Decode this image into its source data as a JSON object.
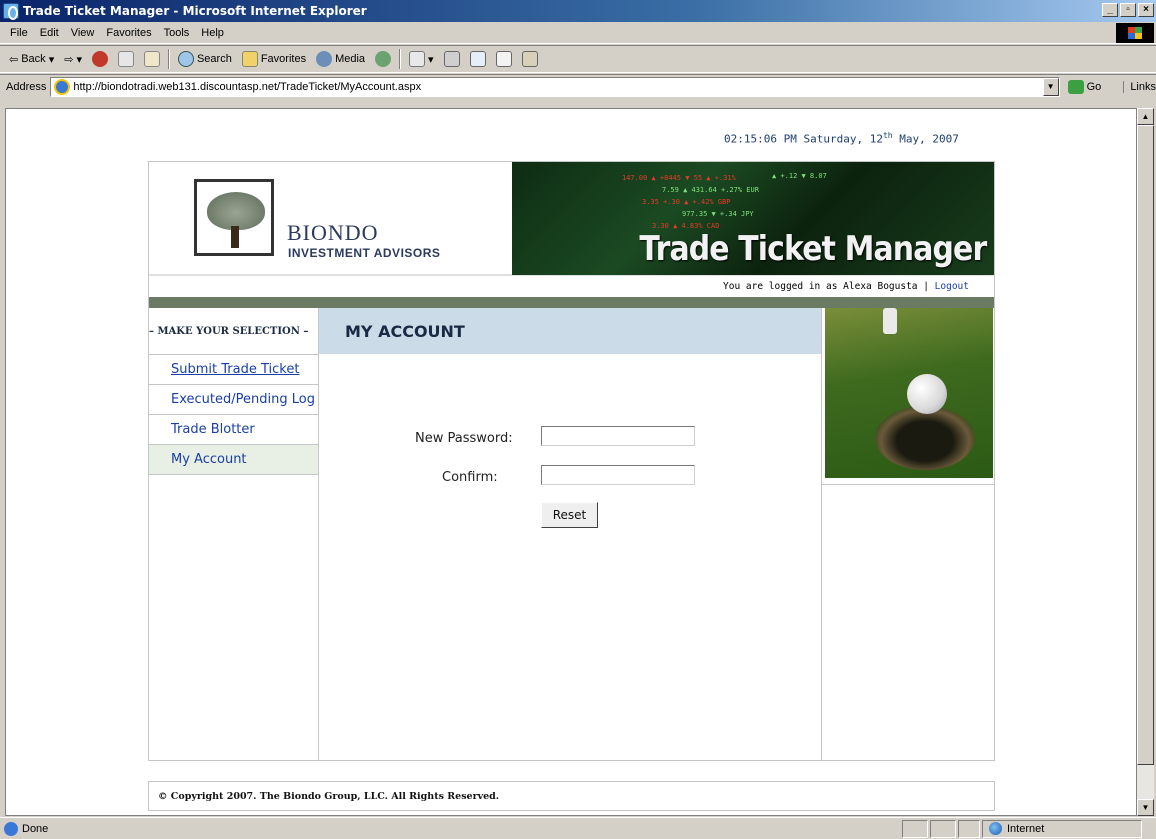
{
  "window": {
    "title": "Trade Ticket Manager - Microsoft Internet Explorer",
    "buttons": {
      "minimize": "_",
      "maximize": "▫",
      "close": "×"
    }
  },
  "menu": {
    "items": [
      "File",
      "Edit",
      "View",
      "Favorites",
      "Tools",
      "Help"
    ]
  },
  "toolbar": {
    "back": "Back",
    "search": "Search",
    "favorites": "Favorites",
    "media": "Media"
  },
  "address": {
    "label": "Address",
    "url": "http://biondotradi.web131.discountasp.net/TradeTicket/MyAccount.aspx",
    "go": "Go",
    "links": "Links"
  },
  "status": {
    "text": "Done",
    "zone": "Internet"
  },
  "page": {
    "datetime": {
      "time_day": "02:15:06 PM Saturday, 12",
      "ordinal": "th",
      "month_year": " May, 2007"
    },
    "brand": {
      "line1": "BIONDO",
      "line2": "INVESTMENT ADVISORS"
    },
    "banner_title": "Trade Ticket Manager",
    "logged_in": {
      "prefix": "You are logged in as Alexa Bogusta | ",
      "logout": "Logout"
    },
    "nav": {
      "heading": "– MAKE YOUR SELECTION –",
      "items": [
        "Submit Trade Ticket",
        "Executed/Pending Log",
        "Trade Blotter",
        "My Account"
      ]
    },
    "section_title": "MY ACCOUNT",
    "form": {
      "new_password_label": "New Password:",
      "confirm_label": "Confirm:",
      "new_password_value": "",
      "confirm_value": "",
      "reset_label": "Reset"
    },
    "footer": "© Copyright 2007. The Biondo Group, LLC. All Rights Reserved."
  }
}
